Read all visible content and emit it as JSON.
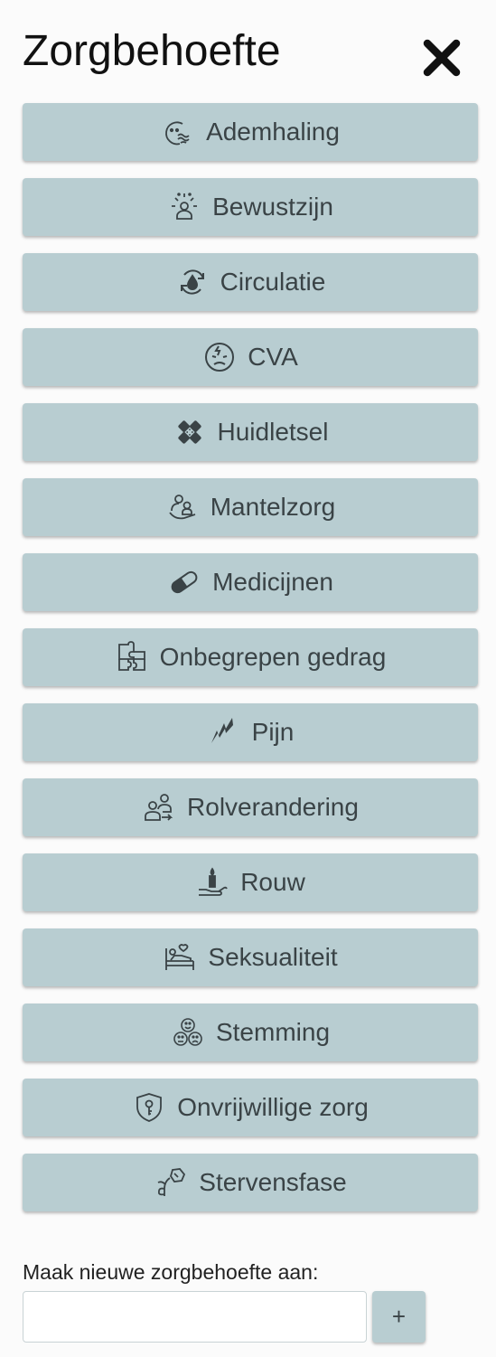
{
  "header": {
    "title": "Zorgbehoefte",
    "close_icon": "close-icon"
  },
  "items": [
    {
      "label": "Ademhaling",
      "icon": "breathing-icon"
    },
    {
      "label": "Bewustzijn",
      "icon": "consciousness-icon"
    },
    {
      "label": "Circulatie",
      "icon": "circulation-icon"
    },
    {
      "label": "CVA",
      "icon": "cva-icon"
    },
    {
      "label": "Huidletsel",
      "icon": "bandage-icon"
    },
    {
      "label": "Mantelzorg",
      "icon": "caregiver-icon"
    },
    {
      "label": "Medicijnen",
      "icon": "pill-icon"
    },
    {
      "label": "Onbegrepen gedrag",
      "icon": "puzzle-icon"
    },
    {
      "label": "Pijn",
      "icon": "pain-icon"
    },
    {
      "label": "Rolverandering",
      "icon": "role-change-icon"
    },
    {
      "label": "Rouw",
      "icon": "candle-hand-icon"
    },
    {
      "label": "Seksualiteit",
      "icon": "bed-icon"
    },
    {
      "label": "Stemming",
      "icon": "mood-faces-icon"
    },
    {
      "label": "Onvrijwillige zorg",
      "icon": "shield-lock-icon"
    },
    {
      "label": "Stervensfase",
      "icon": "wilting-flower-icon"
    }
  ],
  "new_item": {
    "label": "Maak nieuwe zorgbehoefte aan:",
    "input_value": "",
    "add_button_label": "+"
  },
  "colors": {
    "button_bg": "#b8cdd1",
    "button_text": "#3a4346",
    "page_bg": "#fbfbfb"
  }
}
